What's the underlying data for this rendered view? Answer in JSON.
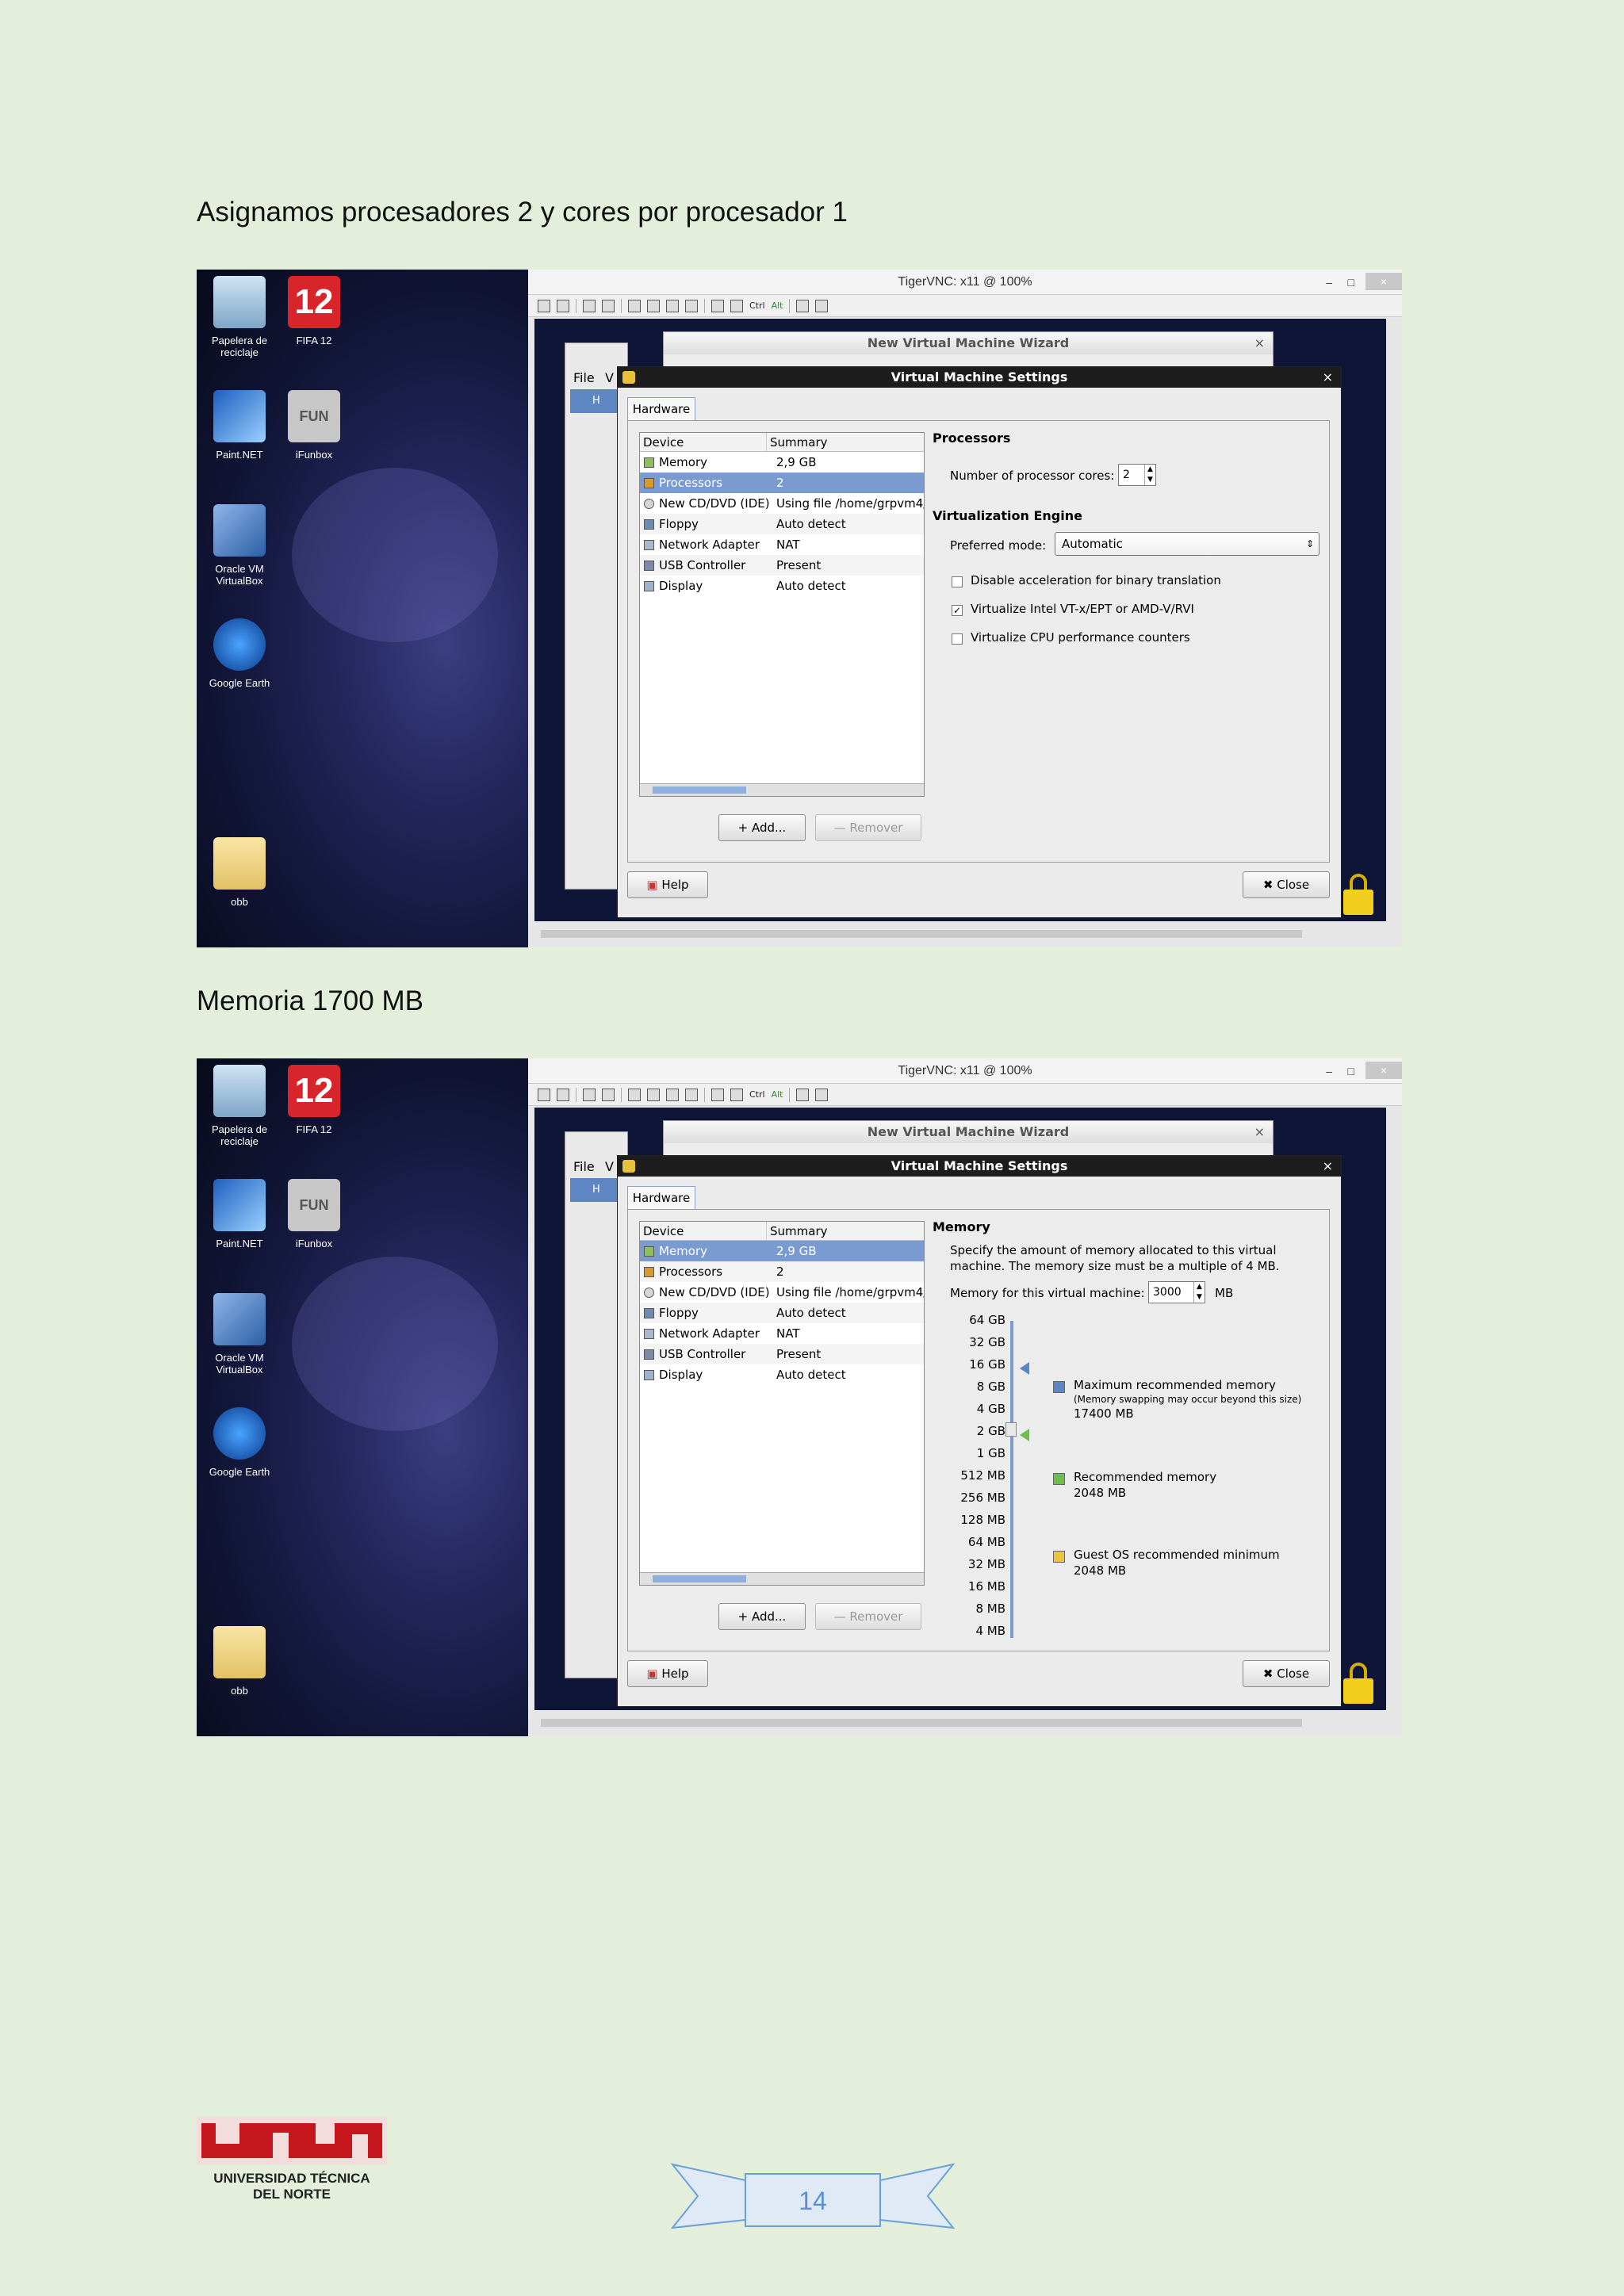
{
  "headings": {
    "first": "Asignamos procesadores 2 y cores por procesador 1",
    "second": "Memoria 1700 MB"
  },
  "desktop_icons": [
    "Papelera de reciclaje",
    "FIFA 12",
    "Paint.NET",
    "iFunbox",
    "Oracle VM VirtualBox",
    "Google Earth",
    "obb"
  ],
  "fifa_number": "12",
  "ifunbox_tag": "FUN",
  "vnc": {
    "title": "TigerVNC: x11 @ 100%",
    "min": "–",
    "max": "□",
    "close": "×",
    "toolbar_ctrl": "Ctrl",
    "toolbar_alt": "Alt"
  },
  "bg_window": {
    "file": "File",
    "v": "V",
    "tab_hi": "H"
  },
  "wizard": {
    "title": "New Virtual Machine Wizard",
    "close": "×"
  },
  "vms": {
    "title": "Virtual Machine Settings",
    "close": "×",
    "tab": "Hardware",
    "col_device": "Device",
    "col_summary": "Summary",
    "devices": [
      {
        "name": "Memory",
        "summary": "2,9 GB",
        "icon": "memory-icon"
      },
      {
        "name": "Processors",
        "summary": "2",
        "icon": "processor-icon"
      },
      {
        "name": "New CD/DVD (IDE)",
        "summary": "Using file /home/grpvm4/",
        "icon": "cdrom-icon"
      },
      {
        "name": "Floppy",
        "summary": "Auto detect",
        "icon": "floppy-icon"
      },
      {
        "name": "Network Adapter",
        "summary": "NAT",
        "icon": "network-icon"
      },
      {
        "name": "USB Controller",
        "summary": "Present",
        "icon": "usb-icon"
      },
      {
        "name": "Display",
        "summary": "Auto detect",
        "icon": "display-icon"
      }
    ],
    "add_btn": "Add...",
    "remove_btn": "Remover",
    "help_btn": "Help",
    "close_btn": "Close"
  },
  "processors_panel": {
    "heading": "Processors",
    "cores_label": "Number of processor cores:",
    "cores_value": "2",
    "engine_heading": "Virtualization Engine",
    "mode_label": "Preferred mode:",
    "mode_value": "Automatic",
    "options": [
      {
        "label": "Disable acceleration for binary translation",
        "checked": false
      },
      {
        "label": "Virtualize Intel VT-x/EPT or AMD-V/RVI",
        "checked": true
      },
      {
        "label": "Virtualize CPU performance counters",
        "checked": false
      }
    ]
  },
  "memory_panel": {
    "heading": "Memory",
    "desc1": "Specify the amount of memory allocated to this virtual",
    "desc2": "machine. The memory size must be a multiple of 4 MB.",
    "size_label": "Memory for this virtual machine:",
    "size_value": "3000",
    "unit": "MB",
    "scale": [
      "64 GB",
      "32 GB",
      "16 GB",
      "8 GB",
      "4 GB",
      "2 GB",
      "1 GB",
      "512 MB",
      "256 MB",
      "128 MB",
      "64 MB",
      "32 MB",
      "16 MB",
      "8 MB",
      "4 MB"
    ],
    "max_label": "Maximum recommended memory",
    "max_note": "(Memory swapping may occur beyond this size)",
    "max_value": "17400 MB",
    "rec_label": "Recommended memory",
    "rec_value": "2048 MB",
    "min_label": "Guest OS recommended minimum",
    "min_value": "2048 MB",
    "colors": {
      "max": "#5b86c4",
      "rec": "#6cc04a",
      "min": "#e8c53a"
    }
  },
  "logo": {
    "line1": "UNIVERSIDAD TÉCNICA",
    "line2": "DEL NORTE"
  },
  "page_number": "14"
}
